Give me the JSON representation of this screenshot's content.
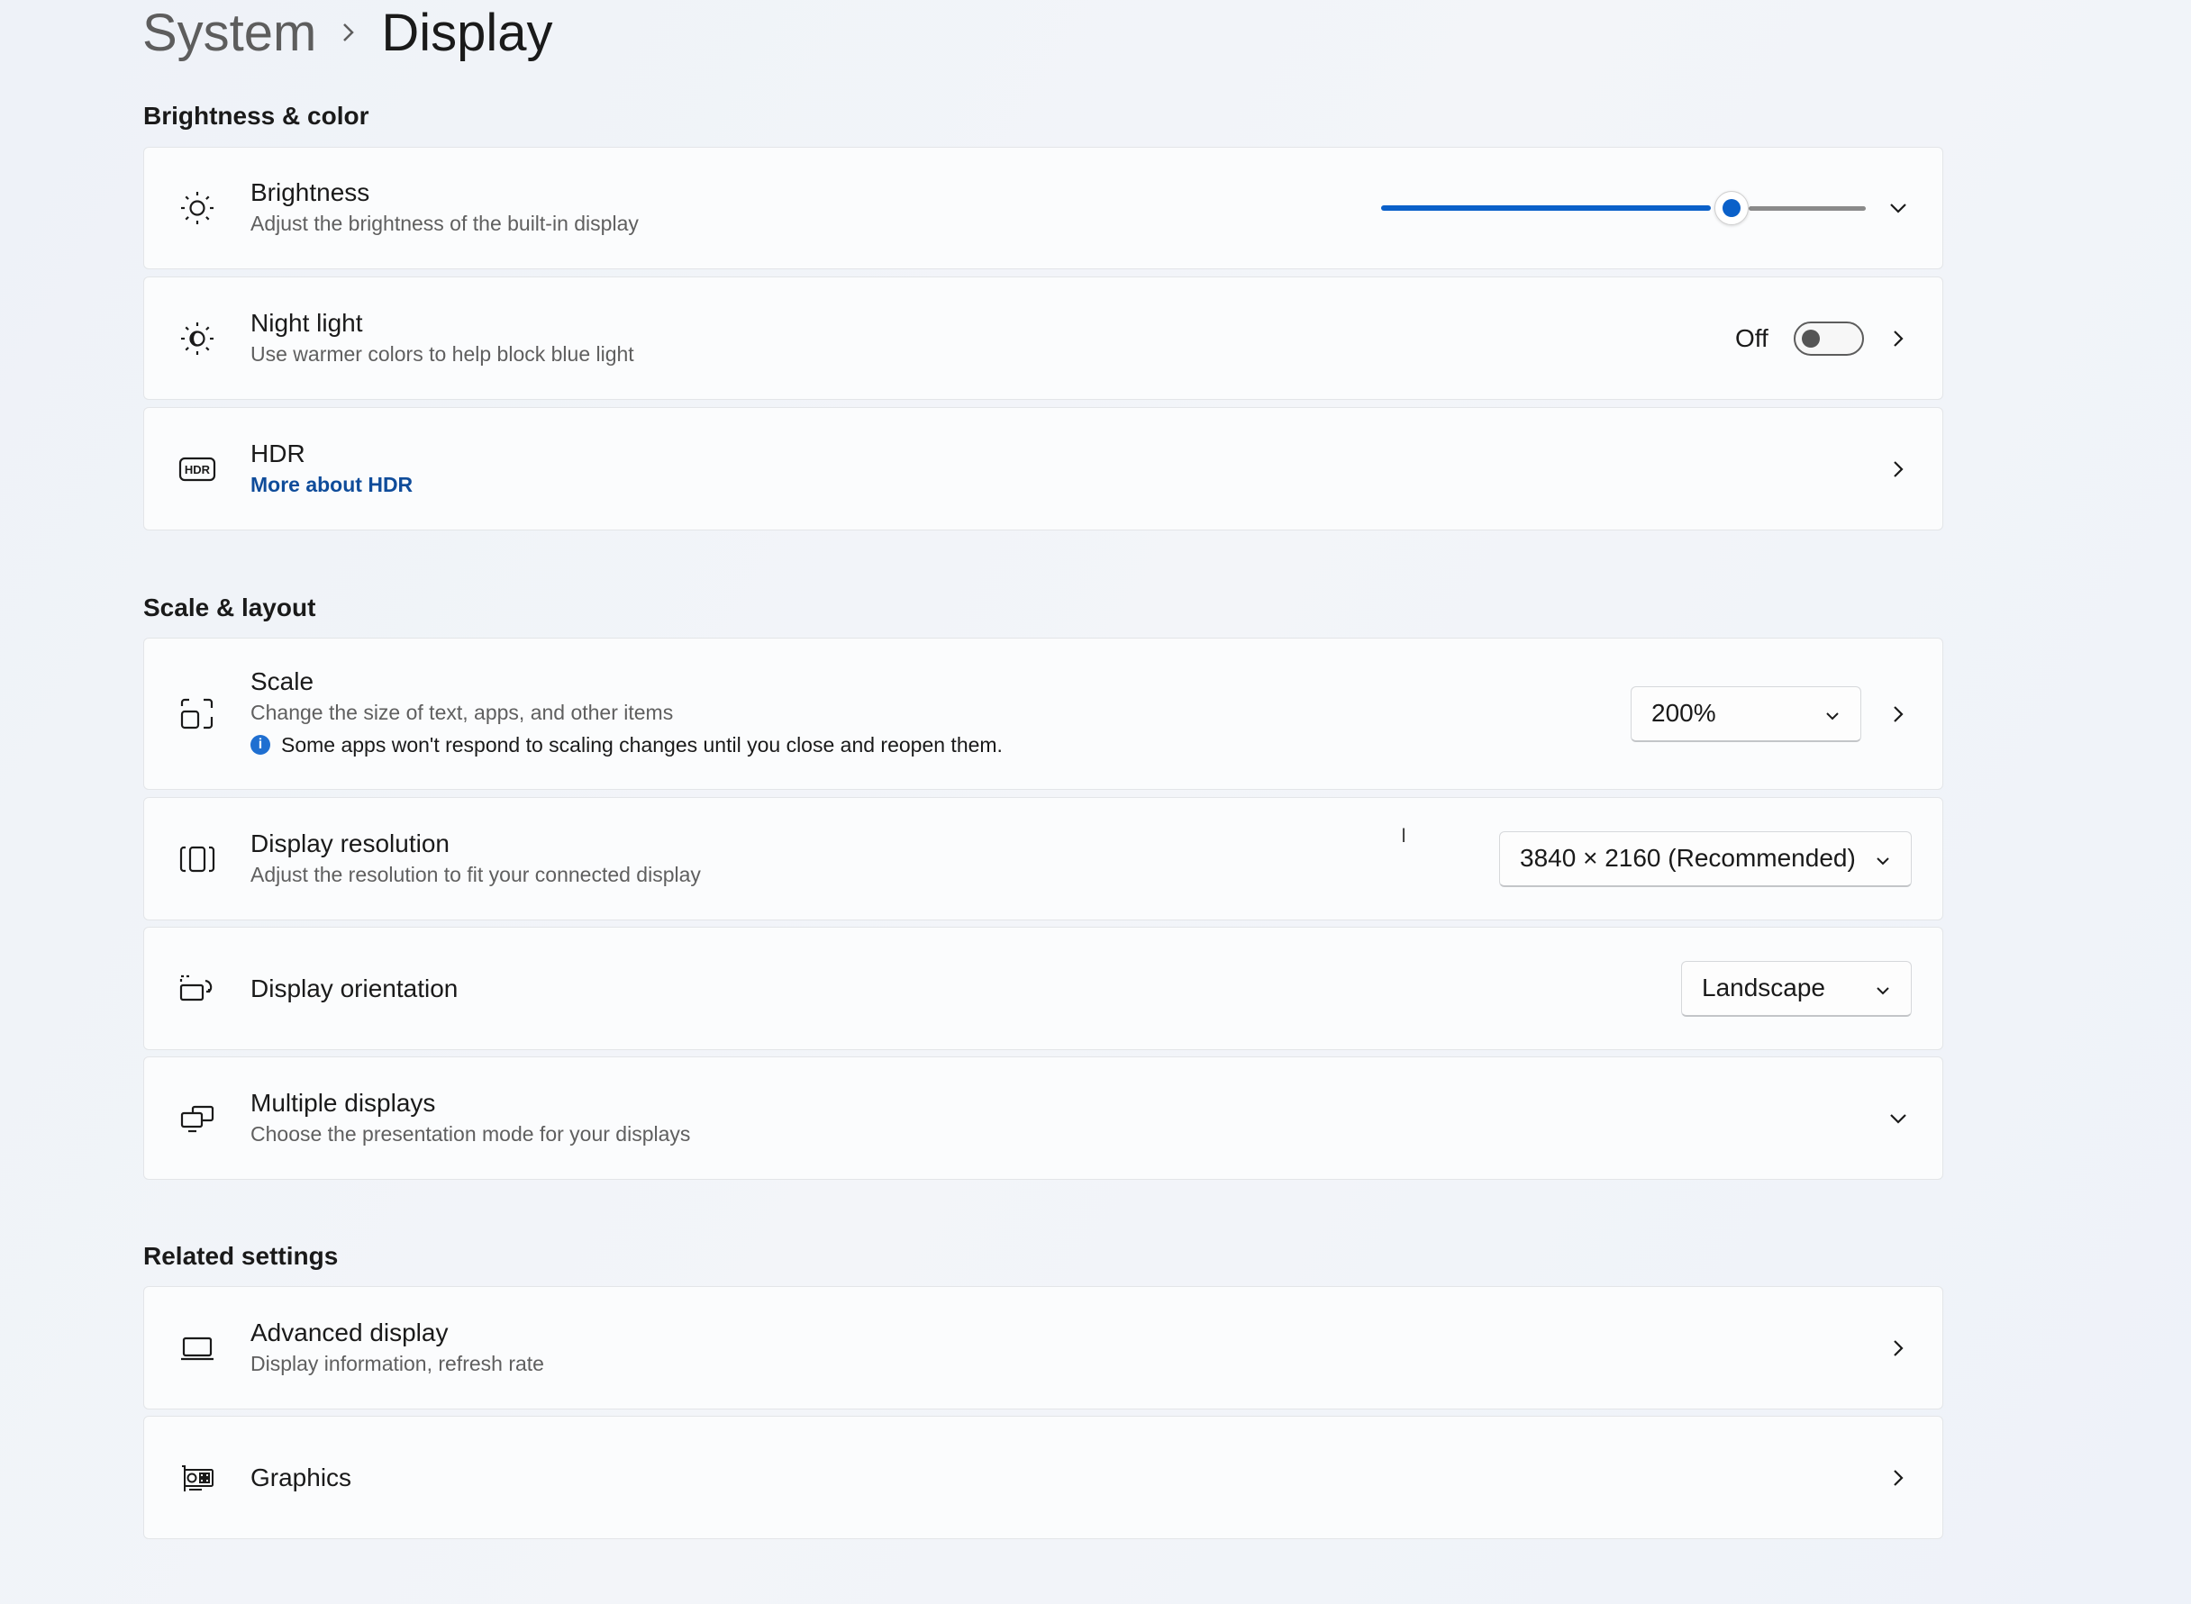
{
  "breadcrumb": {
    "parent": "System",
    "current": "Display"
  },
  "sections": {
    "brightness_color": "Brightness & color",
    "scale_layout": "Scale & layout",
    "related": "Related settings"
  },
  "brightness": {
    "title": "Brightness",
    "subtitle": "Adjust the brightness of the built-in display",
    "value_fraction": 0.74
  },
  "night_light": {
    "title": "Night light",
    "subtitle": "Use warmer colors to help block blue light",
    "state": "Off"
  },
  "hdr": {
    "title": "HDR",
    "link": "More about HDR"
  },
  "scale": {
    "title": "Scale",
    "subtitle": "Change the size of text, apps, and other items",
    "info": "Some apps won't respond to scaling changes until you close and reopen them.",
    "value": "200%"
  },
  "resolution": {
    "title": "Display resolution",
    "subtitle": "Adjust the resolution to fit your connected display",
    "value": "3840 × 2160 (Recommended)"
  },
  "orientation": {
    "title": "Display orientation",
    "value": "Landscape"
  },
  "multiple": {
    "title": "Multiple displays",
    "subtitle": "Choose the presentation mode for your displays"
  },
  "advanced": {
    "title": "Advanced display",
    "subtitle": "Display information, refresh rate"
  },
  "graphics": {
    "title": "Graphics"
  },
  "colors": {
    "accent": "#0a60c9",
    "link": "#0f4c9a",
    "info": "#1f6fd1"
  },
  "icons": [
    "sun-icon",
    "night-light-icon",
    "hdr-icon",
    "scale-icon",
    "resolution-icon",
    "orientation-icon",
    "multiple-displays-icon",
    "laptop-icon",
    "graphics-card-icon",
    "chevron-right-icon",
    "chevron-down-icon",
    "info-icon"
  ]
}
